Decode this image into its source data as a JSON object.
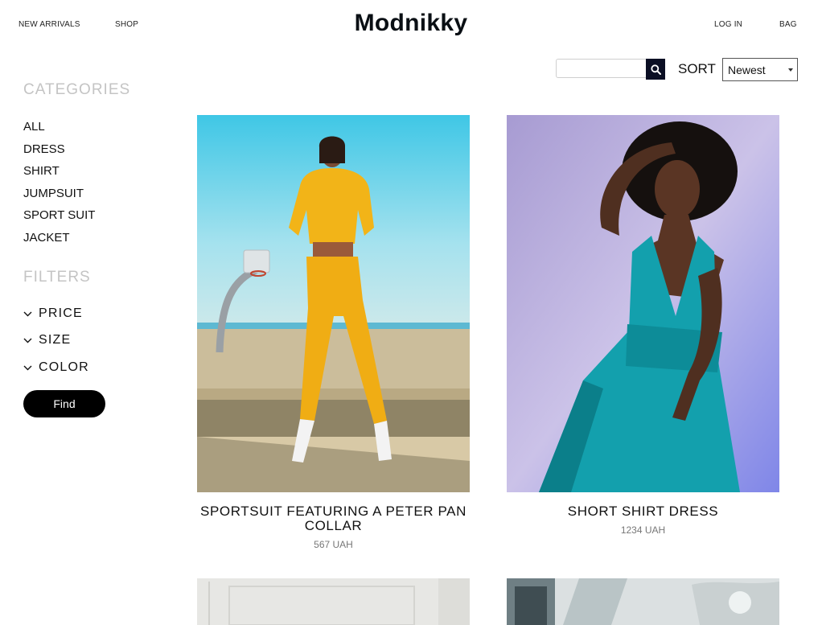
{
  "header": {
    "nav_left": [
      "NEW ARRIVALS",
      "SHOP"
    ],
    "logo": "Modnikky",
    "login": "LOG IN",
    "bag": "BAG"
  },
  "toolbar": {
    "search_placeholder": "",
    "search_value": "",
    "sort_label": "SORT",
    "sort_selected": "Newest"
  },
  "sidebar": {
    "categories_title": "CATEGORIES",
    "categories": [
      "ALL",
      "DRESS",
      "SHIRT",
      "JUMPSUIT",
      "SPORT SUIT",
      "JACKET"
    ],
    "filters_title": "FILTERS",
    "filters": [
      "PRICE",
      "SIZE",
      "COLOR"
    ],
    "find_label": "Find"
  },
  "products": [
    {
      "name": "SPORTSUIT FEATURING A PETER PAN COLLAR",
      "price": "567 UAH",
      "image": "woman-yellow-tracksuit-basketball-court"
    },
    {
      "name": "SHORT SHIRT DRESS",
      "price": "1234 UAH",
      "image": "woman-teal-dress-lavender-wall"
    }
  ],
  "icons": {
    "search": "search-icon",
    "chevron": "chevron-down-icon",
    "caret": "caret-down-icon"
  },
  "colors": {
    "search_button": "#0b0f24",
    "find_button": "#000000",
    "sidebar_heading": "#c4c4c4",
    "price": "#777777"
  }
}
